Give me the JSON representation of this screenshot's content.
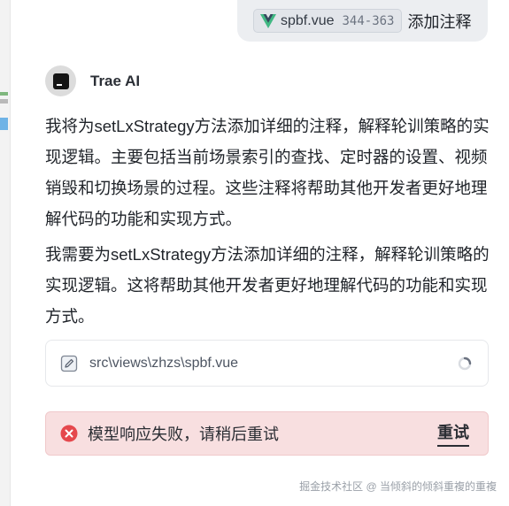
{
  "user_message": {
    "file_chip": {
      "icon": "vue-logo-icon",
      "name": "spbf.vue",
      "range": "344-363"
    },
    "text": "添加注释"
  },
  "assistant": {
    "avatar_icon": "trae-logo-icon",
    "name": "Trae AI",
    "paragraphs": [
      "我将为setLxStrategy方法添加详细的注释，解释轮训策略的实现逻辑。主要包括当前场景索引的查找、定时器的设置、视频销毁和切换场景的过程。这些注释将帮助其他开发者更好地理解代码的功能和实现方式。",
      "我需要为setLxStrategy方法添加详细的注释，解释轮训策略的实现逻辑。这将帮助其他开发者更好地理解代码的功能和实现方式。"
    ]
  },
  "file_card": {
    "icon": "edit-file-icon",
    "path": "src\\views\\zhzs\\spbf.vue",
    "status_icon": "loading-spinner-icon"
  },
  "error": {
    "icon": "error-circle-icon",
    "message": "模型响应失败，请稍后重试",
    "retry_label": "重试"
  },
  "watermark": "掘金技术社区 @ 当倾斜的倾斜重複的重複",
  "colors": {
    "error_bg": "#f8dfe0",
    "vue_green": "#41b883",
    "vue_dark": "#35495e",
    "error_red": "#e5484d"
  }
}
